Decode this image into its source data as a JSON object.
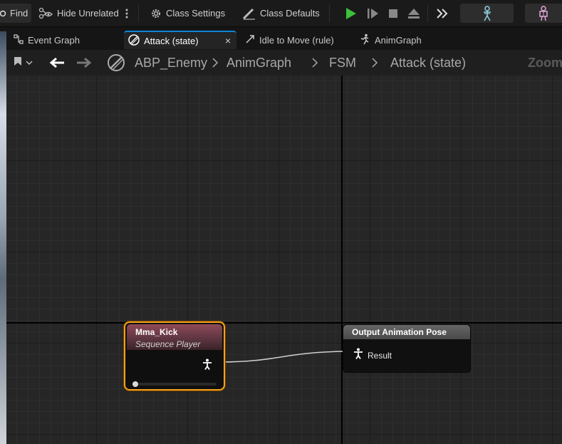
{
  "toolbar": {
    "find_label": "Find",
    "hide_unrelated_label": "Hide Unrelated",
    "class_settings_label": "Class Settings",
    "class_defaults_label": "Class Defaults"
  },
  "tabs": [
    {
      "label": "Event Graph",
      "icon": "graph-icon"
    },
    {
      "label": "Attack (state)",
      "icon": "state-icon",
      "active": true,
      "close": "×"
    },
    {
      "label": "Idle to Move (rule)",
      "icon": "transition-icon"
    },
    {
      "label": "AnimGraph",
      "icon": "running-figure-icon"
    }
  ],
  "breadcrumb": {
    "items": [
      "ABP_Enemy",
      "AnimGraph",
      "FSM",
      "Attack (state)"
    ],
    "zoom_label": "Zoom"
  },
  "nodes": {
    "sequence_player": {
      "title": "Mma_Kick",
      "subtitle": "Sequence Player",
      "progress": 0
    },
    "output_pose": {
      "title": "Output Animation Pose",
      "pin_label": "Result"
    }
  },
  "colors": {
    "accent": "#0e86d4",
    "selected_node_border": "#f7a21b",
    "play_green": "#3cc13b",
    "sequence_header": "#8f4a58"
  }
}
